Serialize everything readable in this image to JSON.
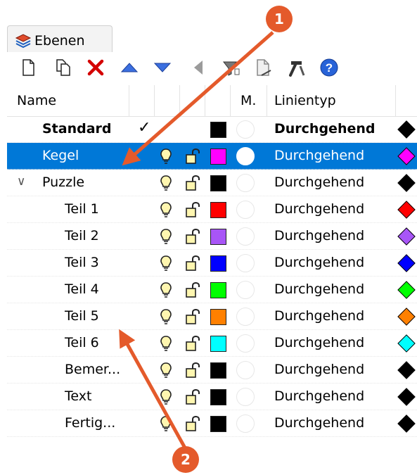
{
  "panel": {
    "tab_label": "Ebenen",
    "tab_icon": "layers-icon"
  },
  "toolbar": {
    "items": [
      {
        "name": "new-layer-icon"
      },
      {
        "name": "new-sublayer-icon"
      },
      {
        "name": "delete-icon",
        "color": "#d40000"
      },
      {
        "name": "move-up-icon",
        "color": "#2b5fd9"
      },
      {
        "name": "move-down-icon",
        "color": "#2b5fd9"
      },
      {
        "name": "previous-icon"
      },
      {
        "name": "filter-icon"
      },
      {
        "name": "document-icon"
      },
      {
        "name": "tools-icon"
      },
      {
        "name": "help-icon",
        "color": "#1f5fd8"
      }
    ]
  },
  "columns": {
    "name": "Name",
    "material": "M.",
    "linetype": "Linientyp"
  },
  "layers": [
    {
      "name": "Standard",
      "bold": true,
      "current": true,
      "indent": 0,
      "has_bulb": false,
      "has_lock": false,
      "color": "#000000",
      "linetype": "Durchgehend",
      "linetype_bold": true,
      "print_color": "#000000"
    },
    {
      "name": "Kegel",
      "indent": 0,
      "selected": true,
      "color": "#ff00ff",
      "linetype": "Durchgehend",
      "print_color": "#ff00ff"
    },
    {
      "name": "Puzzle",
      "indent": 0,
      "expanded": true,
      "color": "#000000",
      "linetype": "Durchgehend",
      "print_color": "#000000"
    },
    {
      "name": "Teil 1",
      "indent": 1,
      "color": "#ff0000",
      "linetype": "Durchgehend",
      "print_color": "#ff0000"
    },
    {
      "name": "Teil 2",
      "indent": 1,
      "color": "#a855f7",
      "linetype": "Durchgehend",
      "print_color": "#a855f7"
    },
    {
      "name": "Teil 3",
      "indent": 1,
      "color": "#0000ff",
      "linetype": "Durchgehend",
      "print_color": "#0000ff"
    },
    {
      "name": "Teil 4",
      "indent": 1,
      "color": "#00ff00",
      "linetype": "Durchgehend",
      "print_color": "#00ff00"
    },
    {
      "name": "Teil 5",
      "indent": 1,
      "color": "#ff8000",
      "linetype": "Durchgehend",
      "print_color": "#ff8000"
    },
    {
      "name": "Teil 6",
      "indent": 1,
      "color": "#00ffff",
      "linetype": "Durchgehend",
      "print_color": "#00ffff"
    },
    {
      "name": "Bemer...",
      "indent": 1,
      "color": "#000000",
      "linetype": "Durchgehend",
      "print_color": "#000000"
    },
    {
      "name": "Text",
      "indent": 1,
      "color": "#000000",
      "linetype": "Durchgehend",
      "print_color": "#000000"
    },
    {
      "name": "Fertig...",
      "indent": 1,
      "color": "#000000",
      "linetype": "Durchgehend",
      "print_color": "#000000"
    }
  ],
  "callouts": [
    {
      "label": "1",
      "color": "#e45a2b"
    },
    {
      "label": "2",
      "color": "#e45a2b"
    }
  ]
}
